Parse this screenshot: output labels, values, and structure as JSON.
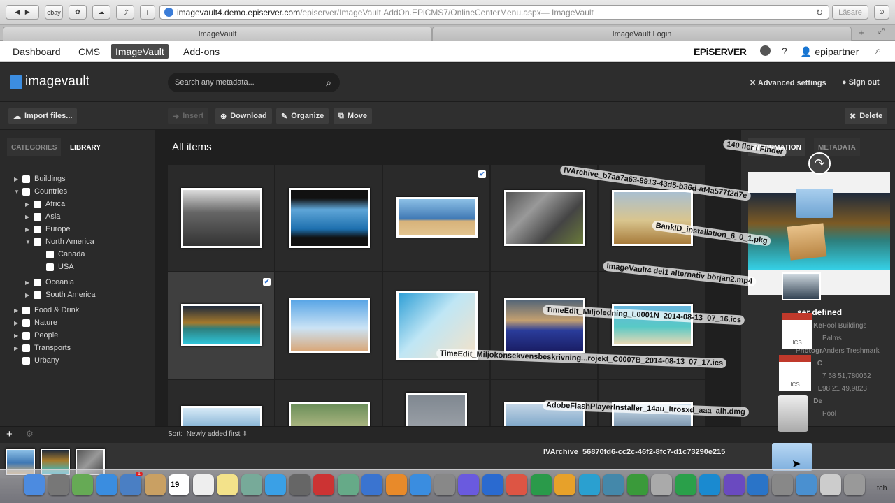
{
  "browser": {
    "url_host": "imagevault4.demo.episerver.com",
    "url_path": "/episerver/ImageVault.AddOn.EPiCMS7/OnlineCenterMenu.aspx",
    "url_title": " — ImageVault",
    "reader_label": "Läsare",
    "ebay_label": "ebay",
    "tabs": [
      "ImageVault",
      "ImageVault Login"
    ]
  },
  "epi": {
    "nav": [
      "Dashboard",
      "CMS",
      "ImageVault",
      "Add-ons"
    ],
    "brand": "EPiSERVER",
    "help": "?",
    "user": "epipartner"
  },
  "app": {
    "logo": "imagevault",
    "search_placeholder": "Search any metadata...",
    "advanced": "Advanced settings",
    "signout": "Sign out"
  },
  "toolbar": {
    "import": "Import files...",
    "insert": "Insert",
    "download": "Download",
    "organize": "Organize",
    "move": "Move",
    "delete": "Delete"
  },
  "sidebar": {
    "tab_categories": "CATEGORIES",
    "tab_library": "LIBRARY",
    "tree": [
      {
        "label": "Buildings",
        "level": 0,
        "arrow": "right"
      },
      {
        "label": "Countries",
        "level": 0,
        "arrow": "down"
      },
      {
        "label": "Africa",
        "level": 1,
        "arrow": "right"
      },
      {
        "label": "Asia",
        "level": 1,
        "arrow": "right"
      },
      {
        "label": "Europe",
        "level": 1,
        "arrow": "right"
      },
      {
        "label": "North America",
        "level": 1,
        "arrow": "down"
      },
      {
        "label": "Canada",
        "level": 2,
        "arrow": ""
      },
      {
        "label": "USA",
        "level": 2,
        "arrow": ""
      },
      {
        "label": "Oceania",
        "level": 1,
        "arrow": "right"
      },
      {
        "label": "South America",
        "level": 1,
        "arrow": "right"
      },
      {
        "label": "Food & Drink",
        "level": 0,
        "arrow": "right"
      },
      {
        "label": "Nature",
        "level": 0,
        "arrow": "right"
      },
      {
        "label": "People",
        "level": 0,
        "arrow": "right"
      },
      {
        "label": "Transports",
        "level": 0,
        "arrow": "right"
      },
      {
        "label": "Urbany",
        "level": 0,
        "arrow": ""
      }
    ]
  },
  "main": {
    "title": "All items",
    "sort_label": "Sort:",
    "sort_value": "Newly added first"
  },
  "info": {
    "tab_information": "INFORMATION",
    "tab_metadata": "METADATA",
    "title": "...ser defined",
    "rows": [
      {
        "label": "Ke",
        "value": "Pool Buildings"
      },
      {
        "label": "",
        "value": "Palms"
      },
      {
        "label": "Photogr",
        "value": "Anders Treshmark"
      },
      {
        "label": "C",
        "value": ""
      },
      {
        "label": "",
        "value": "7 58 51,780052"
      },
      {
        "label": "L",
        "value": "98 21 49,9823"
      },
      {
        "label": "De",
        "value": ""
      },
      {
        "label": "",
        "value": "Pool"
      }
    ]
  },
  "drag": {
    "count": "140 fler i Finder",
    "files": [
      "IVArchive_b7aa7a63-8913-43d5-b36d-af4a577f2d7e",
      "BankID_installation_6_0_1.pkg",
      "ImageVault4 del1 alternativ början2.mp4",
      "TimeEdit_Miljoledning_L0001N_2014-08-13_07_16.ics",
      "TimeEdit_Miljokonsekvensbeskrivning...rojekt_C0007B_2014-08-13_07_17.ics",
      "AdobeFlashPlayerInstaller_14au_ltrosxd_aaa_aih.dmg",
      "IVArchive_56870fd6-cc2c-46f2-8fc7-d1c73290e215"
    ],
    "ics": "ICS"
  },
  "dock": {
    "calendar_day": "19",
    "badge": "1",
    "trailing": "tch"
  }
}
